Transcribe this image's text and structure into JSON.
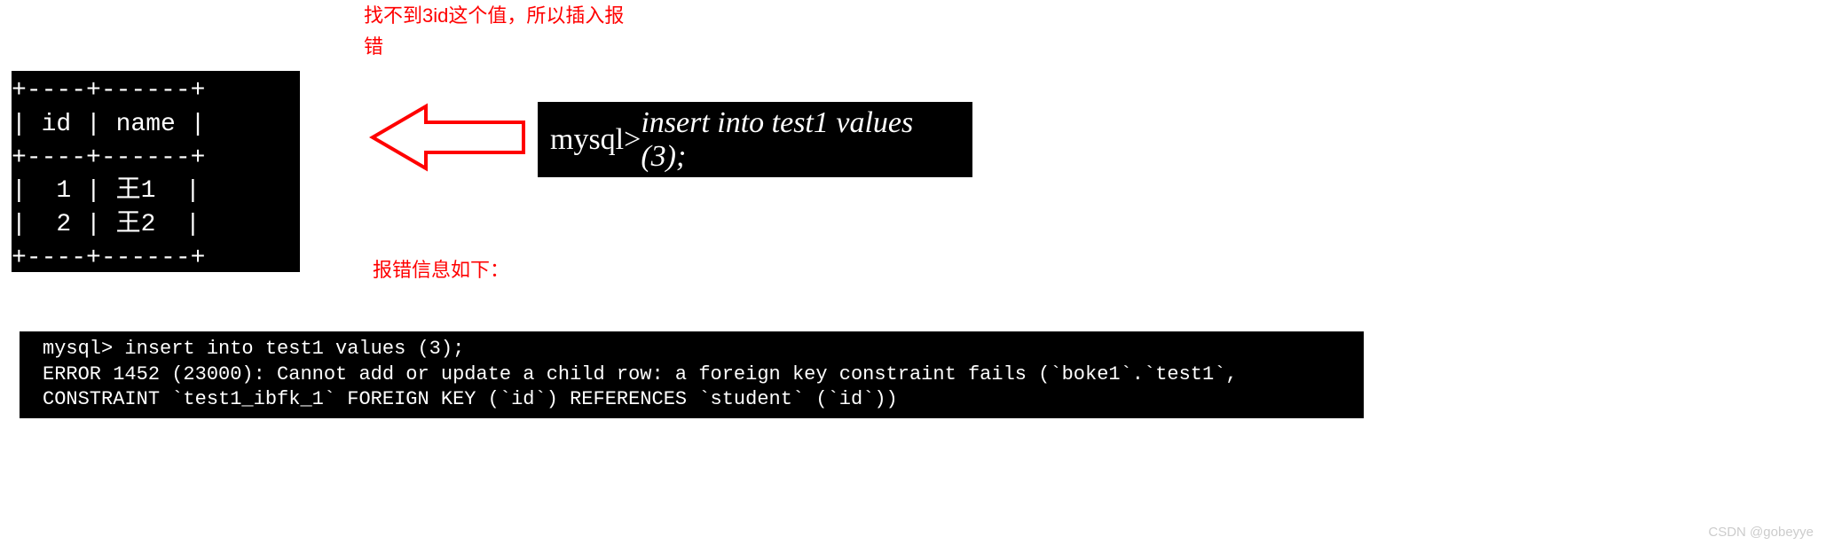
{
  "note_top_line1": "找不到3id这个值，所以插入报",
  "note_top_line2": "错",
  "note_mid": "报错信息如下：",
  "table": {
    "border_top": "+----+------+",
    "header": "| id | name |",
    "border_mid": "+----+------+",
    "row1": "|  1 | 王1  |",
    "row2": "|  2 | 王2  |",
    "border_bot": "+----+------+"
  },
  "command": {
    "prompt": "mysql> ",
    "sql": "insert into test1 values (3);"
  },
  "error_text": "mysql> insert into test1 values (3);\nERROR 1452 (23000): Cannot add or update a child row: a foreign key constraint fails (`boke1`.`test1`, CONSTRAINT `test1_ibfk_1` FOREIGN KEY (`id`) REFERENCES `student` (`id`))",
  "watermark": "CSDN @gobeyye"
}
